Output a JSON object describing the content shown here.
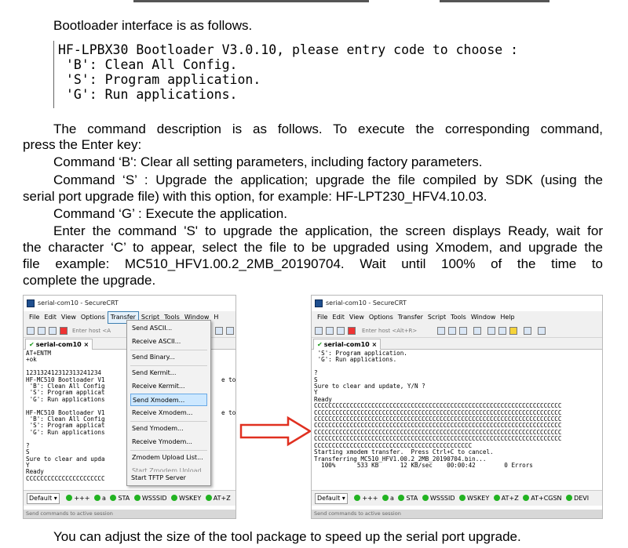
{
  "text": {
    "intro": "Bootloader interface is as follows.",
    "code_lines": [
      "HF-LPBX30 Bootloader V3.0.10, please entry code to choose :",
      " 'B': Clean All Config.",
      " 'S': Program application.",
      " 'G': Run applications."
    ],
    "cmd_desc_line1": "The command description is as follows. To execute the corresponding command,",
    "cmd_desc_line2": "press the Enter key:",
    "cmd_b": "Command ‘B': Clear all setting parameters, including factory parameters.",
    "cmd_s_line1": "Command ‘S’ : Upgrade the application; upgrade the file compiled by SDK (using the",
    "cmd_s_line2": "serial port upgrade file) with this option, for example: HF-LPT230_HFV4.10.03.",
    "cmd_g": "Command ‘G’ : Execute the application.",
    "upgrade_line1": "Enter the command 'S' to upgrade the application, the screen displays Ready, wait for",
    "upgrade_line2": "the character ‘C’ to appear, select the file to be upgraded using Xmodem, and upgrade the",
    "upgrade_line3": "file example: MC510_HFV1.00.2_2MB_20190704. Wait until 100% of the time to",
    "upgrade_line4": "complete the upgrade.",
    "bottom": "You can adjust the size of the tool package to speed up the serial port upgrade."
  },
  "left_window": {
    "title": "serial-com10 - SecureCRT",
    "menu": [
      "File",
      "Edit",
      "View",
      "Options",
      "Transfer",
      "Script",
      "Tools",
      "Window",
      "H"
    ],
    "host_placeholder": "Enter host <A",
    "tab": "serial-com10",
    "tab_close": "×",
    "terminal": "AT+ENTM\n+ok\n\n123132412312313241234\nHF-MC510 Bootloader V1\n 'B': Clean All Config\n 'S': Program applicat\n 'G': Run applications\n\nHF-MC510 Bootloader V1\n 'B': Clean All Config\n 'S': Program applicat\n 'G': Run applications\n\n?\nS\nSure to clear and upda\nY\nReady\nCCCCCCCCCCCCCCCCCCCCCC",
    "terminal_right_1": "e to c",
    "terminal_right_2": "e to c",
    "status": {
      "session": "Default",
      "indicators": [
        "+++",
        "a",
        "STA",
        "WSSSID",
        "WSKEY",
        "AT+Z"
      ]
    },
    "footer": "Send commands to active session"
  },
  "transfer_menu": {
    "items": [
      "Send ASCII...",
      "Receive ASCII...",
      "Send Binary...",
      "Send Kermit...",
      "Receive Kermit...",
      "Send Xmodem...",
      "Receive Xmodem...",
      "Send Ymodem...",
      "Receive Ymodem...",
      "Zmodem Upload List...",
      "Start Zmodem Upload",
      "Start TFTP Server"
    ],
    "highlighted": "Send Xmodem..."
  },
  "right_window": {
    "title": "serial-com10 - SecureCRT",
    "menu": [
      "File",
      "Edit",
      "View",
      "Options",
      "Transfer",
      "Script",
      "Tools",
      "Window",
      "Help"
    ],
    "host_placeholder": "Enter host <Alt+R>",
    "tab": "serial-com10",
    "tab_close": "×",
    "terminal": " 'S': Program application.\n 'G': Run applications.\n\n?\nS\nSure to clear and update, Y/N ?\nY\nReady\nCCCCCCCCCCCCCCCCCCCCCCCCCCCCCCCCCCCCCCCCCCCCCCCCCCCCCCCCCCCCCCCCCCCCC\nCCCCCCCCCCCCCCCCCCCCCCCCCCCCCCCCCCCCCCCCCCCCCCCCCCCCCCCCCCCCCCCCCCCCC\nCCCCCCCCCCCCCCCCCCCCCCCCCCCCCCCCCCCCCCCCCCCCCCCCCCCCCCCCCCCCCCCCCCCCC\nCCCCCCCCCCCCCCCCCCCCCCCCCCCCCCCCCCCCCCCCCCCCCCCCCCCCCCCCCCCCCCCCCCCCC\nCCCCCCCCCCCCCCCCCCCCCCCCCCCCCCCCCCCCCCCCCCCCCCCCCCCCCCCCCCCCCCCCCCCCC\nCCCCCCCCCCCCCCCCCCCCCCCCCCCCCCCCCCCCCCCCCCCCCCCCCCCCCCCCCCCCCCCCCCCCC\nCCCCCCCCCCCCCCCCCCCCCCCCCCCCCCCCCCCCCCCCCCCC\nStarting xmodem transfer.  Press Ctrl+C to cancel.\nTransferring MC510_HFV1.00.2_2MB_20190704.bin...\n  100%      533 KB      12 KB/sec    00:00:42        0 Errors",
    "status": {
      "session": "Default",
      "indicators": [
        "+++",
        "a",
        "STA",
        "WSSSID",
        "WSKEY",
        "AT+Z",
        "AT+CGSN",
        "DEVI"
      ]
    },
    "footer": "Send commands to active session"
  },
  "colors": {
    "arrow": "#e03020",
    "led": "#22b322",
    "menu_highlight": "#cde8ff"
  }
}
